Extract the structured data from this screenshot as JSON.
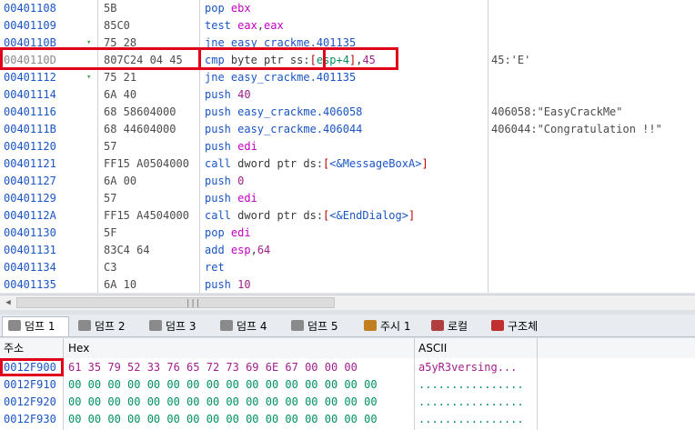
{
  "disasm": {
    "rows": [
      {
        "addr": "00401108",
        "arrow": "",
        "bytes": "5B",
        "ins": [
          [
            "mn",
            "pop "
          ],
          [
            "reg",
            "ebx"
          ]
        ],
        "cmt": ""
      },
      {
        "addr": "00401109",
        "arrow": "",
        "bytes": "85C0",
        "ins": [
          [
            "mn",
            "test "
          ],
          [
            "reg",
            "eax"
          ],
          [
            "ptr",
            ","
          ],
          [
            "reg",
            "eax"
          ]
        ],
        "cmt": ""
      },
      {
        "addr": "0040110B",
        "arrow": "▾",
        "bytes": "75 28",
        "ins": [
          [
            "mn",
            "jne "
          ],
          [
            "lab",
            "easy_crackme.401135"
          ]
        ],
        "cmt": ""
      },
      {
        "addr": "0040110D",
        "arrow": "",
        "bytes": "807C24 04 45",
        "ins": [
          [
            "mn",
            "cmp "
          ],
          [
            "ptr",
            "byte ptr ss:"
          ],
          [
            "br",
            "["
          ],
          [
            "gr",
            "esp+4"
          ],
          [
            "br",
            "]"
          ],
          [
            "ptr",
            ","
          ],
          [
            "num",
            "45"
          ]
        ],
        "cmt": "45:'E'"
      },
      {
        "addr": "00401112",
        "arrow": "▾",
        "bytes": "75 21",
        "ins": [
          [
            "mn",
            "jne "
          ],
          [
            "lab",
            "easy_crackme.401135"
          ]
        ],
        "cmt": ""
      },
      {
        "addr": "00401114",
        "arrow": "",
        "bytes": "6A 40",
        "ins": [
          [
            "mn",
            "push "
          ],
          [
            "num",
            "40"
          ]
        ],
        "cmt": ""
      },
      {
        "addr": "00401116",
        "arrow": "",
        "bytes": "68 58604000",
        "ins": [
          [
            "mn",
            "push "
          ],
          [
            "lab",
            "easy_crackme.406058"
          ]
        ],
        "cmt": "406058:\"EasyCrackMe\""
      },
      {
        "addr": "0040111B",
        "arrow": "",
        "bytes": "68 44604000",
        "ins": [
          [
            "mn",
            "push "
          ],
          [
            "lab",
            "easy_crackme.406044"
          ]
        ],
        "cmt": "406044:\"Congratulation !!\""
      },
      {
        "addr": "00401120",
        "arrow": "",
        "bytes": "57",
        "ins": [
          [
            "mn",
            "push "
          ],
          [
            "reg",
            "edi"
          ]
        ],
        "cmt": ""
      },
      {
        "addr": "00401121",
        "arrow": "",
        "bytes": "FF15 A0504000",
        "ins": [
          [
            "mn",
            "call "
          ],
          [
            "ptr",
            "dword ptr ds:"
          ],
          [
            "br",
            "["
          ],
          [
            "lab",
            "<&MessageBoxA>"
          ],
          [
            "br",
            "]"
          ]
        ],
        "cmt": ""
      },
      {
        "addr": "00401127",
        "arrow": "",
        "bytes": "6A 00",
        "ins": [
          [
            "mn",
            "push "
          ],
          [
            "num",
            "0"
          ]
        ],
        "cmt": ""
      },
      {
        "addr": "00401129",
        "arrow": "",
        "bytes": "57",
        "ins": [
          [
            "mn",
            "push "
          ],
          [
            "reg",
            "edi"
          ]
        ],
        "cmt": ""
      },
      {
        "addr": "0040112A",
        "arrow": "",
        "bytes": "FF15 A4504000",
        "ins": [
          [
            "mn",
            "call "
          ],
          [
            "ptr",
            "dword ptr ds:"
          ],
          [
            "br",
            "["
          ],
          [
            "lab",
            "<&EndDialog>"
          ],
          [
            "br",
            "]"
          ]
        ],
        "cmt": ""
      },
      {
        "addr": "00401130",
        "arrow": "",
        "bytes": "5F",
        "ins": [
          [
            "mn",
            "pop "
          ],
          [
            "reg",
            "edi"
          ]
        ],
        "cmt": ""
      },
      {
        "addr": "00401131",
        "arrow": "",
        "bytes": "83C4 64",
        "ins": [
          [
            "mn",
            "add "
          ],
          [
            "reg",
            "esp"
          ],
          [
            "ptr",
            ","
          ],
          [
            "num",
            "64"
          ]
        ],
        "cmt": ""
      },
      {
        "addr": "00401134",
        "arrow": "",
        "bytes": "C3",
        "ins": [
          [
            "mn",
            "ret"
          ]
        ],
        "cmt": ""
      },
      {
        "addr": "00401135",
        "arrow": "",
        "bytes": "6A 10",
        "ins": [
          [
            "mn",
            "push "
          ],
          [
            "num",
            "10"
          ]
        ],
        "cmt": ""
      }
    ]
  },
  "scrollbar": {
    "left_arrow": "◀",
    "grip": "|||"
  },
  "tabs": [
    {
      "label": "덤프 1",
      "icon": "dump-icon",
      "color": "#8a8a8a",
      "active": true
    },
    {
      "label": "덤프 2",
      "icon": "dump-icon",
      "color": "#8a8a8a",
      "active": false
    },
    {
      "label": "덤프 3",
      "icon": "dump-icon",
      "color": "#8a8a8a",
      "active": false
    },
    {
      "label": "덤프 4",
      "icon": "dump-icon",
      "color": "#8a8a8a",
      "active": false
    },
    {
      "label": "덤프 5",
      "icon": "dump-icon",
      "color": "#8a8a8a",
      "active": false
    },
    {
      "label": "주시 1",
      "icon": "watch-icon",
      "color": "#c08020",
      "active": false
    },
    {
      "label": "로컬",
      "icon": "locals-icon",
      "color": "#b04040",
      "active": false
    },
    {
      "label": "구조체",
      "icon": "struct-icon",
      "color": "#c03030",
      "active": false
    }
  ],
  "dump": {
    "headers": {
      "address": "주소",
      "hex": "Hex",
      "ascii": "ASCII"
    },
    "rows": [
      {
        "addr": "0012F900",
        "hex": "61 35 79 52 33 76 65 72 73 69 6E 67 00 00 00",
        "ascii": "a5yR3versing...",
        "highlight": true
      },
      {
        "addr": "0012F910",
        "hex": "00 00 00 00 00 00 00 00 00 00 00 00 00 00 00 00",
        "ascii": "................",
        "highlight": false
      },
      {
        "addr": "0012F920",
        "hex": "00 00 00 00 00 00 00 00 00 00 00 00 00 00 00 00",
        "ascii": "................",
        "highlight": false
      },
      {
        "addr": "0012F930",
        "hex": "00 00 00 00 00 00 00 00 00 00 00 00 00 00 00 00",
        "ascii": "................",
        "highlight": false
      }
    ]
  },
  "colors": {
    "highlight_box": "#e0001b",
    "address": "#1a55c2",
    "bytes_green": "#009060"
  }
}
